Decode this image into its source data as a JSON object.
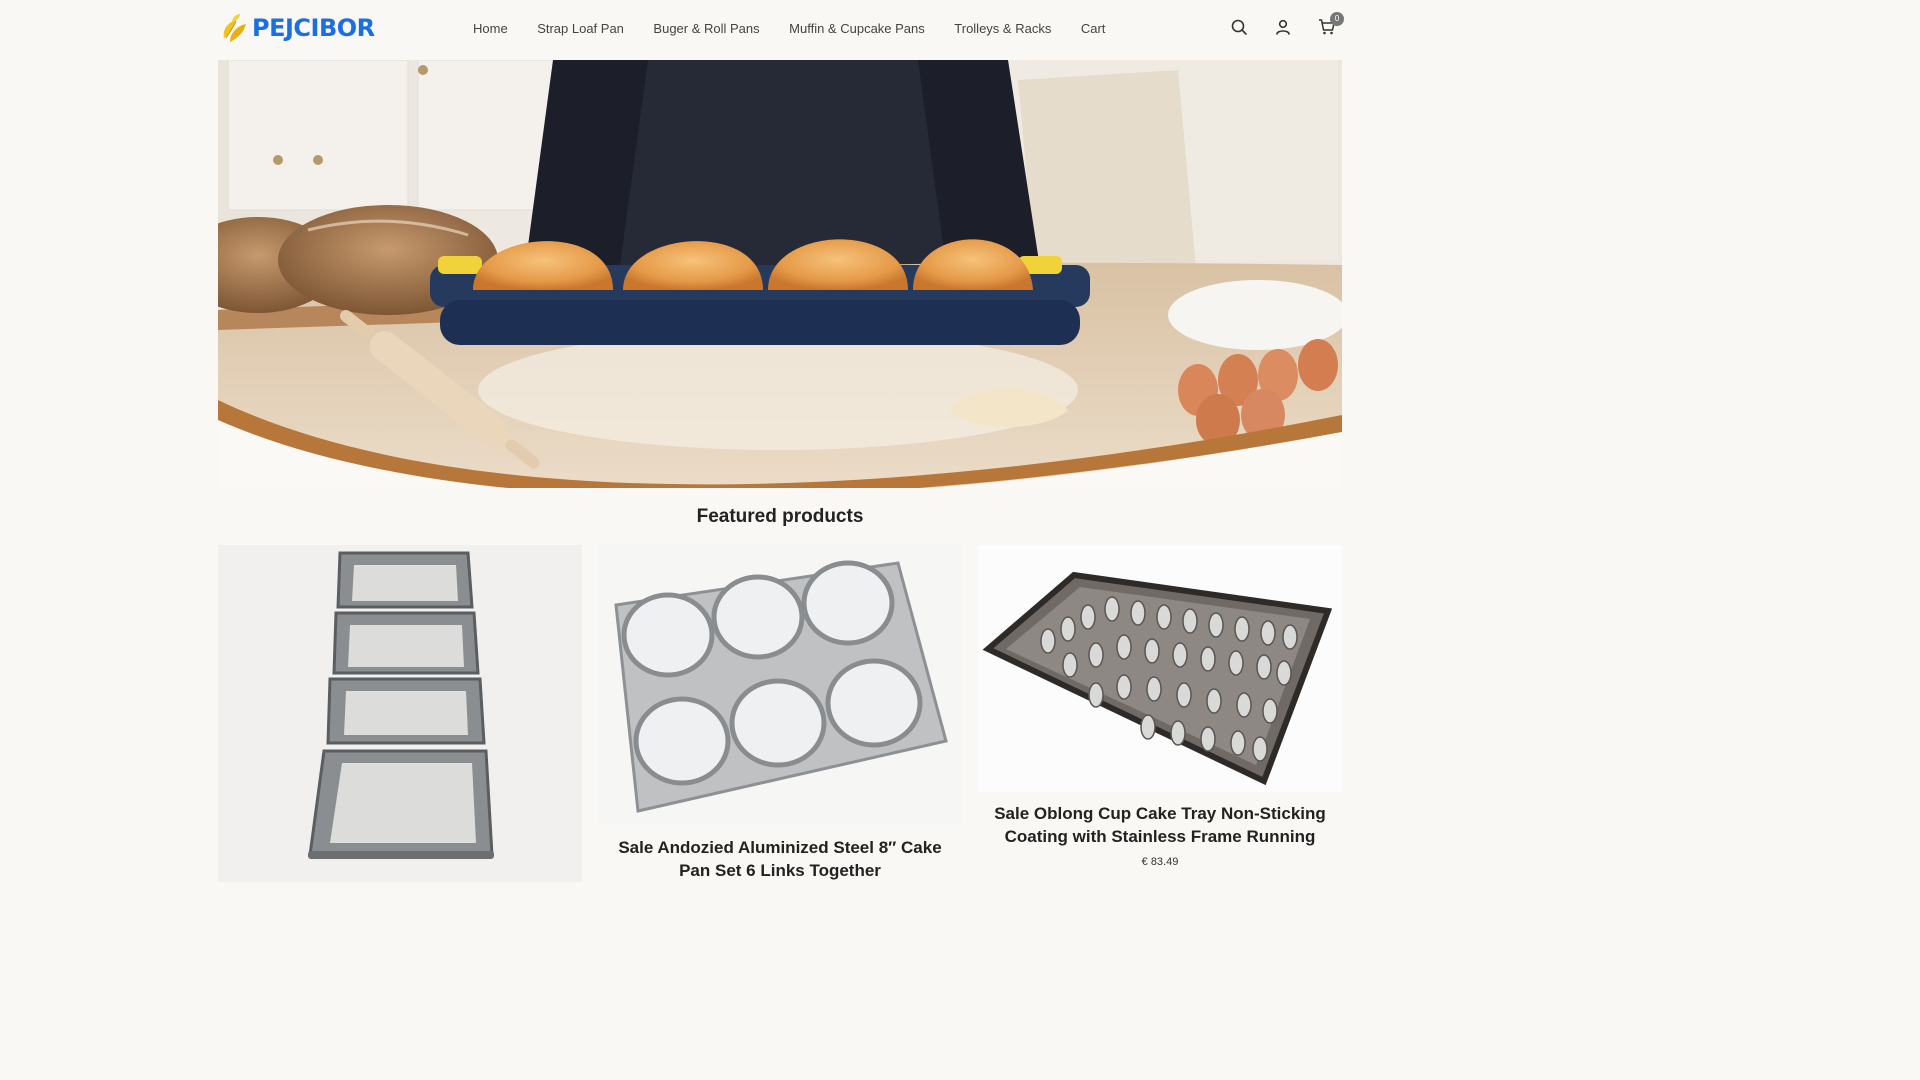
{
  "brand": {
    "name": "PEJCIBOR",
    "color": "#1d6fe0",
    "accent": "#f2c21b"
  },
  "nav": {
    "items": [
      {
        "label": "Home"
      },
      {
        "label": "Strap Loaf Pan"
      },
      {
        "label": "Buger & Roll Pans"
      },
      {
        "label": "Muffin & Cupcake Pans"
      },
      {
        "label": "Trolleys & Racks"
      },
      {
        "label": "Cart"
      }
    ]
  },
  "header_icons": {
    "search": "search-icon",
    "account": "user-icon",
    "cart": "cart-icon",
    "cart_count": "0"
  },
  "hero": {
    "image": "bread-loaf-pan-kitchen-banner"
  },
  "featured": {
    "title": "Featured products",
    "products": [
      {
        "title": "",
        "price": "",
        "image": "strap-loaf-pan-4-links"
      },
      {
        "title": "Sale Andozied Aluminized Steel 8″ Cake Pan Set 6 Links Together",
        "price": "",
        "image": "round-cake-pan-set-6"
      },
      {
        "title": "Sale Oblong Cup Cake Tray Non-Sticking Coating with Stainless Frame Running",
        "price": "€ 83.49",
        "image": "oblong-cupcake-tray"
      }
    ]
  }
}
